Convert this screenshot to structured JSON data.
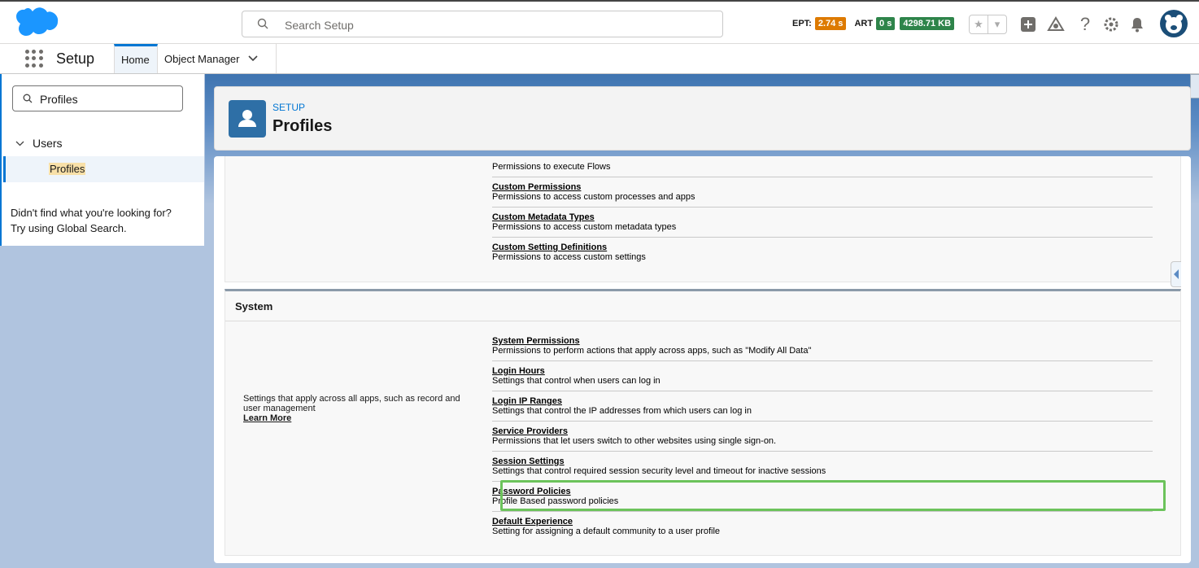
{
  "header": {
    "search_placeholder": "Search Setup",
    "metrics": [
      {
        "label": "EPT:",
        "value": "2.74 s",
        "color": "#dd7a01"
      },
      {
        "label": "ART",
        "value": "0 s",
        "color": "#2e844a"
      },
      {
        "label": "",
        "value": "4298.71 KB",
        "color": "#2e844a"
      }
    ]
  },
  "nav": {
    "app_name": "Setup",
    "tabs": [
      {
        "label": "Home"
      },
      {
        "label": "Object Manager"
      }
    ]
  },
  "sidebar": {
    "search_value": "Profiles",
    "tree_parent": "Users",
    "tree_child": "Profiles",
    "help_line1": "Didn't find what you're looking for?",
    "help_line2": "Try using Global Search."
  },
  "page_header": {
    "kicker": "SETUP",
    "title": "Profiles"
  },
  "app_section": {
    "items": [
      {
        "title": "",
        "desc": "Permissions to execute Flows"
      },
      {
        "title": "Custom Permissions",
        "desc": "Permissions to access custom processes and apps"
      },
      {
        "title": "Custom Metadata Types",
        "desc": "Permissions to access custom metadata types"
      },
      {
        "title": "Custom Setting Definitions",
        "desc": "Permissions to access custom settings"
      }
    ]
  },
  "system_section": {
    "title": "System",
    "description": "Settings that apply across all apps, such as record and user management",
    "learn_more": "Learn More",
    "items": [
      {
        "title": "System Permissions",
        "desc": "Permissions to perform actions that apply across apps, such as \"Modify All Data\""
      },
      {
        "title": "Login Hours",
        "desc": "Settings that control when users can log in"
      },
      {
        "title": "Login IP Ranges",
        "desc": "Settings that control the IP addresses from which users can log in"
      },
      {
        "title": "Service Providers",
        "desc": "Permissions that let users switch to other websites using single sign-on."
      },
      {
        "title": "Session Settings",
        "desc": "Settings that control required session security level and timeout for inactive sessions"
      },
      {
        "title": "Password Policies",
        "desc": "Profile Based password policies"
      },
      {
        "title": "Default Experience",
        "desc": "Setting for assigning a default community to a user profile"
      }
    ]
  },
  "colors": {
    "brand": "#0176d3",
    "highlight": "#6cc35b"
  }
}
